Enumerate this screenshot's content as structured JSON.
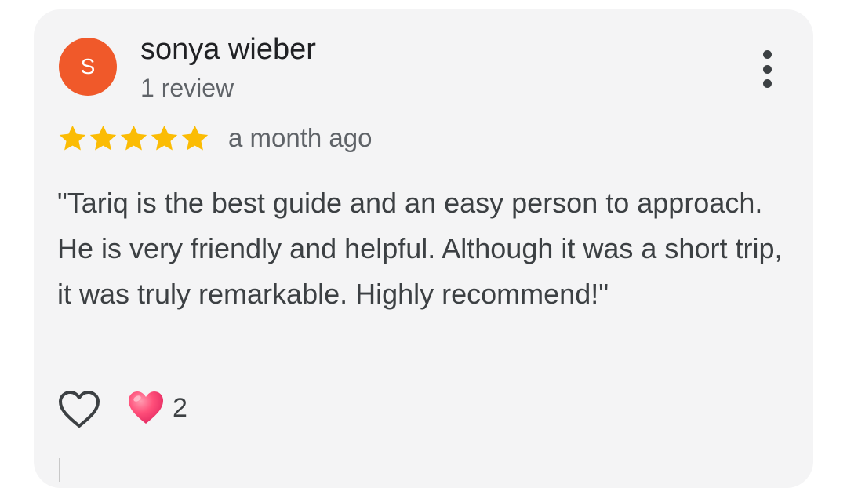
{
  "review": {
    "avatar_letter": "S",
    "author": "sonya wieber",
    "review_count": "1 review",
    "rating": 5,
    "rating_max": 5,
    "time": "a month ago",
    "text": "\"Tariq is the best guide and an easy person to approach. He is very friendly and helpful. Although it was a short trip, it was truly remarkable. Highly recommend!\"",
    "reactions": {
      "like_icon": "heart-outline-icon",
      "heart_icon": "heart-emoji-icon",
      "heart_count": "2"
    }
  },
  "colors": {
    "avatar_bg": "#f0592a",
    "star": "#fbbc04",
    "card_bg": "#f4f4f5"
  }
}
